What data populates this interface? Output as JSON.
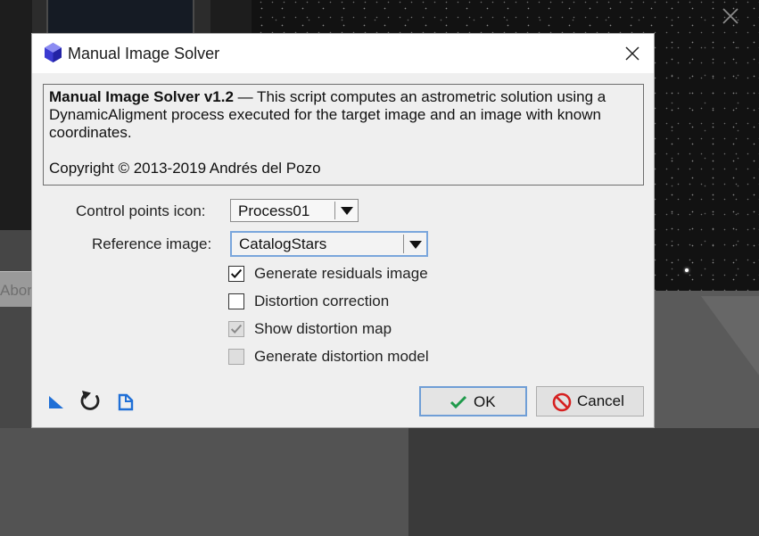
{
  "background": {
    "abort_button_label": "Abor"
  },
  "dialog": {
    "title": "Manual Image Solver",
    "info": {
      "name": "Manual Image Solver v1.2",
      "description": " — This script computes an astrometric solution using a DynamicAligment process executed for the target image and an image with known coordinates.",
      "copyright": "Copyright © 2013-2019 Andrés del Pozo"
    },
    "control_points": {
      "label": "Control points icon:",
      "value": "Process01"
    },
    "reference_image": {
      "label": "Reference image:",
      "value": "CatalogStars"
    },
    "options": [
      {
        "label": "Generate residuals image",
        "checked": true,
        "enabled": true
      },
      {
        "label": "Distortion correction",
        "checked": false,
        "enabled": true
      },
      {
        "label": "Show distortion map",
        "checked": true,
        "enabled": false
      },
      {
        "label": "Generate distortion model",
        "checked": false,
        "enabled": false
      }
    ],
    "toolbar_icons": [
      "new-instance-icon",
      "reset-icon",
      "documentation-icon"
    ],
    "buttons": {
      "ok_label": "OK",
      "cancel_label": "Cancel"
    },
    "colors": {
      "accent": "#1f6fd6",
      "ok_check": "#1f9a4b",
      "cancel_icon": "#d62020",
      "focus_border": "#7aa6dc"
    }
  }
}
